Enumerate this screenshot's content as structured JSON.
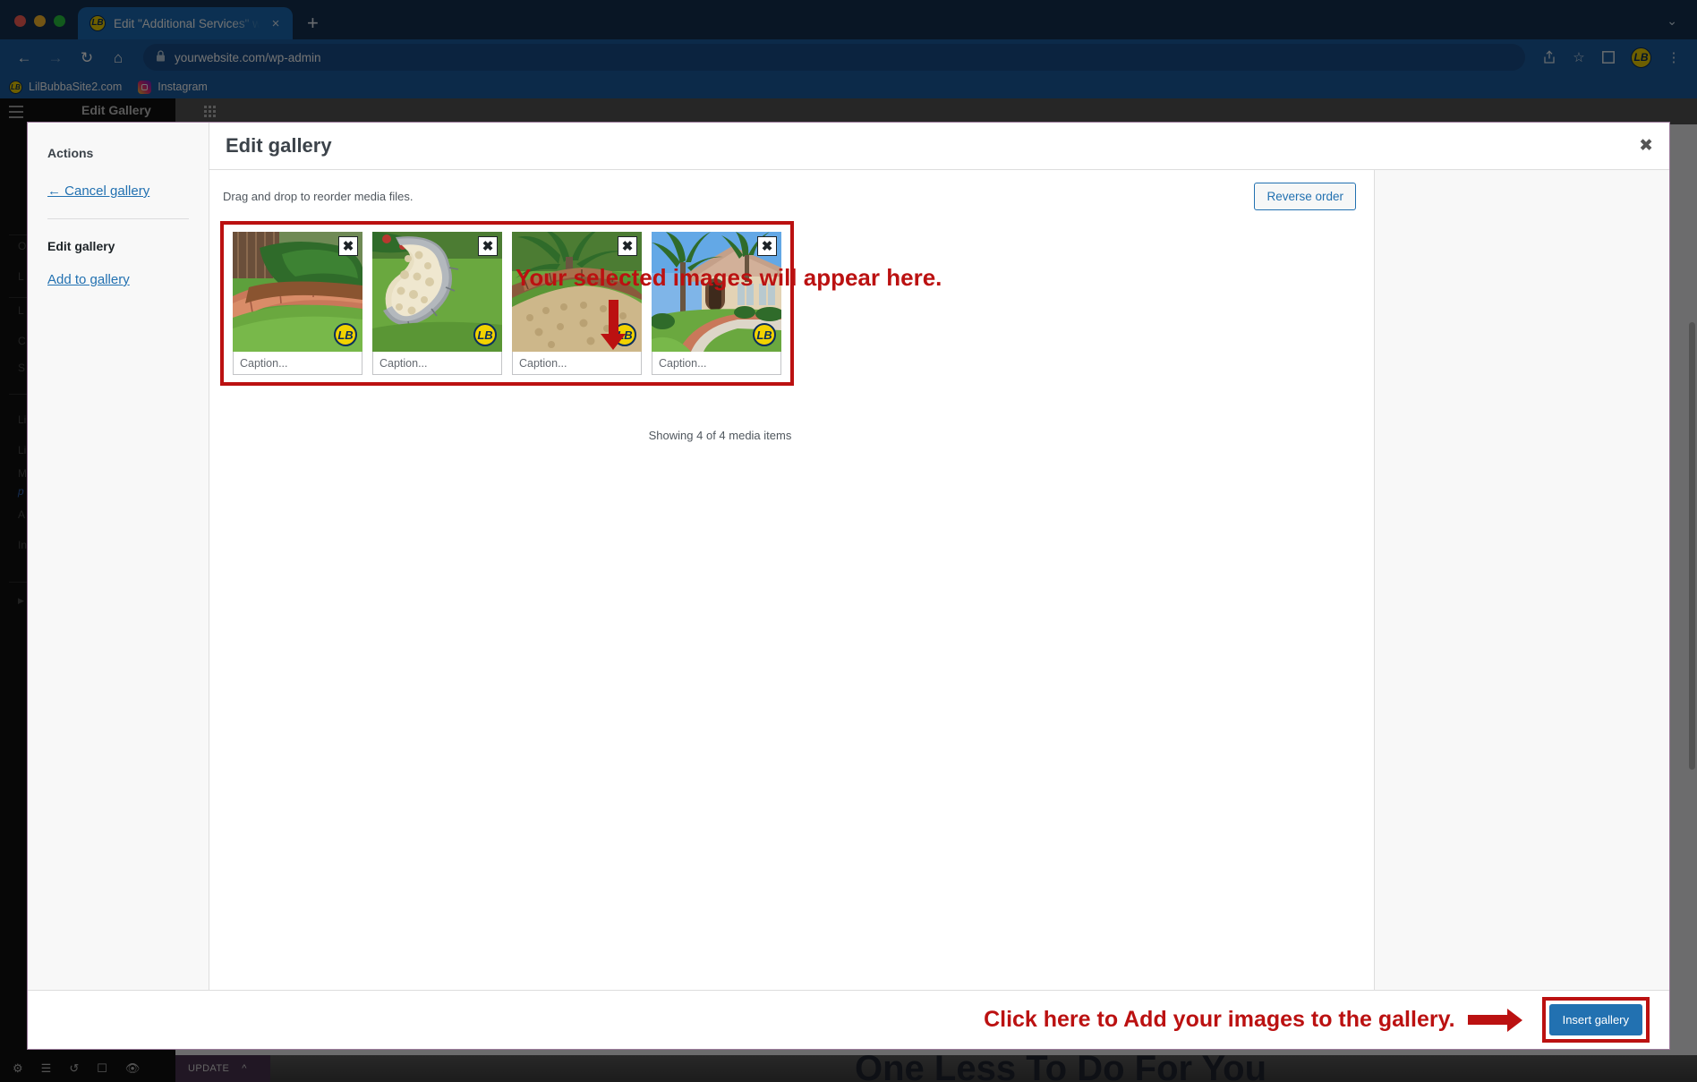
{
  "browser": {
    "tab": {
      "title": "Edit \"Additional Services\" with",
      "favicon": "lilbubba-favicon",
      "close": "×"
    },
    "new_tab": "+",
    "collapse_chevron": "⌄",
    "nav": {
      "back": "←",
      "forward": "→",
      "reload": "↻",
      "home": "⌂"
    },
    "omnibox": {
      "url": "yourwebsite.com/wp-admin",
      "lock": "🔒"
    },
    "actions": {
      "share": "↑",
      "bookmark": "☆",
      "sidepanel": "□",
      "menu": "⋮",
      "profile": "LB"
    },
    "bookmarks": [
      {
        "label": "LilBubbaSite2.com",
        "icon": "lilbubba-favicon"
      },
      {
        "label": "Instagram",
        "icon": "instagram-icon"
      }
    ]
  },
  "page_behind": {
    "editor_title": "Edit Gallery",
    "hero_heading": "One Less To Do For You",
    "update_label": "UPDATE",
    "sidebar_fragments": [
      "O",
      "L",
      "L",
      "C",
      "S",
      "Li",
      "Li",
      "M",
      "p",
      "A",
      "In"
    ]
  },
  "modal": {
    "sidebar": {
      "actions_heading": "Actions",
      "cancel_link": "← Cancel gallery",
      "edit_gallery_heading": "Edit gallery",
      "add_to_gallery_link": "Add to gallery"
    },
    "title": "Edit gallery",
    "close_label": "✖",
    "drag_hint": "Drag and drop to reorder media files.",
    "reverse_order_label": "Reverse order",
    "showing_text": "Showing 4 of 4 media items",
    "insert_gallery_label": "Insert gallery",
    "thumbnails": [
      {
        "remove_label": "✖",
        "caption_placeholder": "Caption...",
        "watermark": "LB",
        "alt": "curved red brick lawn edging around mulched shrub bed"
      },
      {
        "remove_label": "✖",
        "caption_placeholder": "Caption...",
        "watermark": "LB",
        "alt": "grey concrete curbing around white rock landscape bed"
      },
      {
        "remove_label": "✖",
        "caption_placeholder": "Caption...",
        "watermark": "LB",
        "alt": "brick edging lining a gravel path with palm tree"
      },
      {
        "remove_label": "✖",
        "caption_placeholder": "Caption...",
        "watermark": "LB",
        "alt": "front yard of tan house with palms and curbed walkway"
      }
    ]
  },
  "annotations": {
    "top_text": "Your selected images will appear here.",
    "bottom_text": "Click here to Add your images to the gallery.",
    "color": "#bb1111"
  }
}
